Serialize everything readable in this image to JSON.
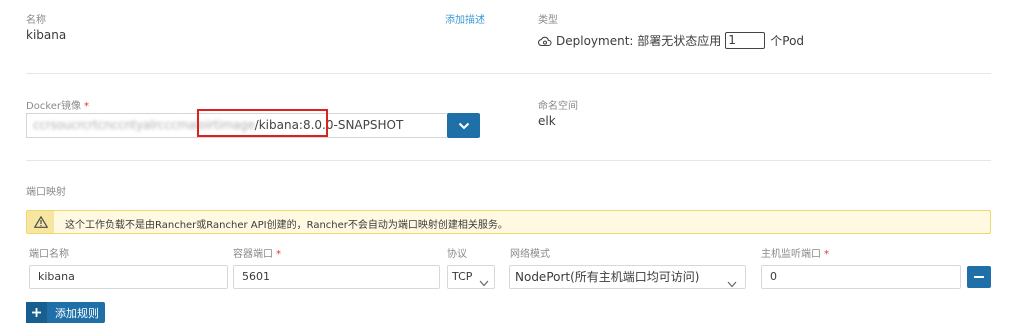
{
  "name": {
    "label": "名称",
    "value": "kibana",
    "add_description": "添加描述"
  },
  "type": {
    "label": "类型",
    "icon": "deployment-icon",
    "text": "Deployment: 部署无状态应用",
    "pod_count": "1",
    "pod_suffix": "个Pod"
  },
  "docker_image": {
    "label": "Docker镜像",
    "required_mark": "*",
    "value_hidden": "ccrsoucrcrtcnccntyalrcccmaloirtimage",
    "value_visible": "/kibana:8.0.0-SNAPSHOT"
  },
  "namespace": {
    "label": "命名空间",
    "value": "elk"
  },
  "ports": {
    "section_label": "端口映射",
    "warning": "这个工作负载不是由Rancher或Rancher API创建的，Rancher不会自动为端口映射创建相关服务。",
    "columns": {
      "port_name": "端口名称",
      "container_port": "容器端口",
      "protocol": "协议",
      "network_mode": "网络模式",
      "host_port": "主机监听端口"
    },
    "required_mark": "*",
    "row": {
      "port_name": "kibana",
      "container_port": "5601",
      "protocol": "TCP",
      "network_mode": "NodePort(所有主机端口均可访问)",
      "host_port": "0"
    },
    "add_rule": "添加规则"
  },
  "colors": {
    "accent": "#1f70a8",
    "link": "#3d98d3",
    "highlight": "#e02020",
    "warning_bg": "#fff9e1"
  }
}
